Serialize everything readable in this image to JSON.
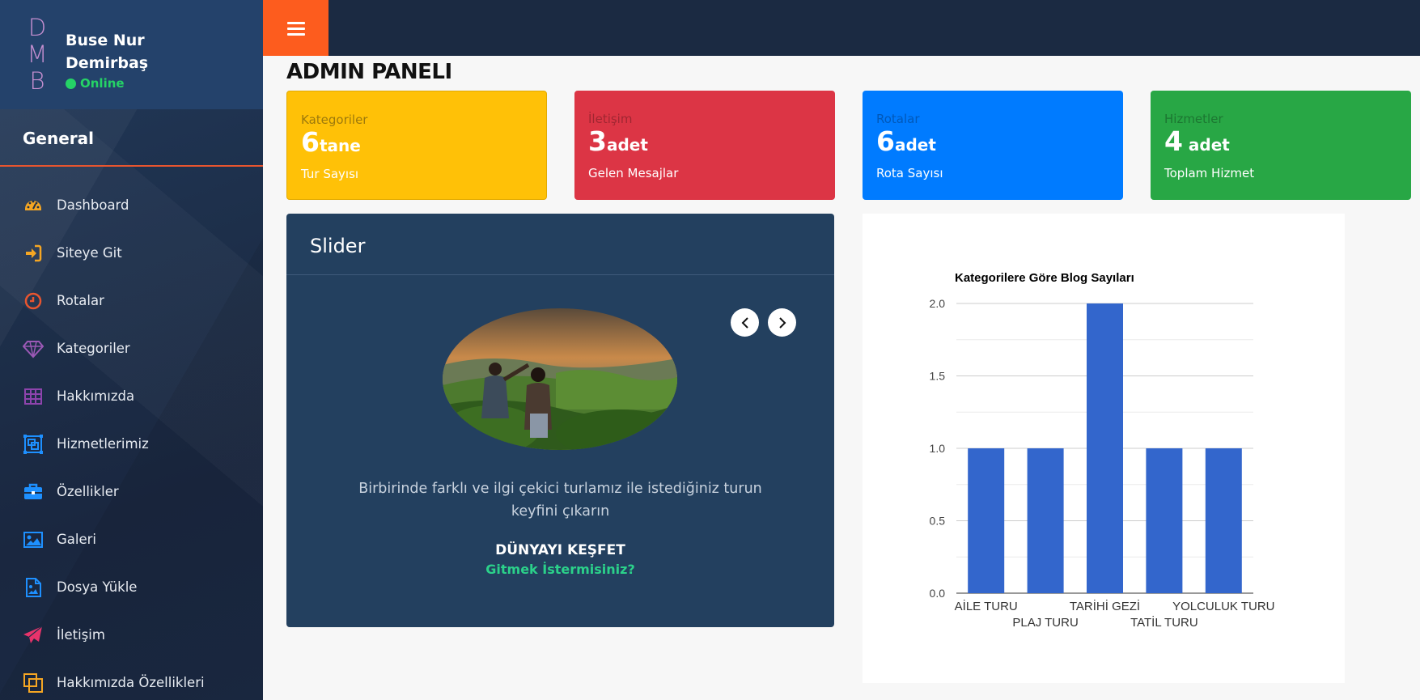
{
  "sidebar": {
    "logo_letters": [
      "D",
      "M",
      "B"
    ],
    "user_name": "Buse Nur Demirbaş",
    "status": "Online",
    "section_title": "General",
    "items": [
      {
        "label": "Dashboard",
        "icon": "speedometer-icon",
        "color": "#f5a623"
      },
      {
        "label": "Siteye Git",
        "icon": "sign-in-icon",
        "color": "#f5a623"
      },
      {
        "label": "Rotalar",
        "icon": "clock-icon",
        "color": "#e8552f"
      },
      {
        "label": "Kategoriler",
        "icon": "diamond-icon",
        "color": "#8e44ad"
      },
      {
        "label": "Hakkımızda",
        "icon": "table-icon",
        "color": "#8e44ad"
      },
      {
        "label": "Hizmetlerimiz",
        "icon": "object-group-icon",
        "color": "#1e90ff"
      },
      {
        "label": "Özellikler",
        "icon": "briefcase-icon",
        "color": "#1e90ff"
      },
      {
        "label": "Galeri",
        "icon": "image-icon",
        "color": "#1e90ff"
      },
      {
        "label": "Dosya Yükle",
        "icon": "file-image-icon",
        "color": "#1e90ff"
      },
      {
        "label": "İletişim",
        "icon": "paper-plane-icon",
        "color": "#e8336b"
      },
      {
        "label": "Hakkımızda Özellikleri",
        "icon": "copy-icon",
        "color": "#f5a623"
      }
    ]
  },
  "header": {
    "menu_icon": "hamburger-icon",
    "page_title": "ADMIN PANELI"
  },
  "cards": [
    {
      "caption": "Kategoriler",
      "number": "6",
      "unit": "tane",
      "subtitle": "Tur Sayısı",
      "color": "#ffc107"
    },
    {
      "caption": "İletişim",
      "number": "3",
      "unit": "adet",
      "subtitle": "Gelen Mesajlar",
      "color": "#dc3545"
    },
    {
      "caption": "Rotalar",
      "number": "6",
      "unit": "adet",
      "subtitle": "Rota Sayısı",
      "color": "#007bff"
    },
    {
      "caption": "Hizmetler",
      "number": "4",
      "unit": " adet",
      "subtitle": "Toplam Hizmet",
      "color": "#28a745"
    }
  ],
  "slider": {
    "title": "Slider",
    "text": "Birbirinde farklı ve ilgi çekici turlamız ile istediğiniz turun keyfini çıkarın",
    "heading": "DÜNYAYI KEŞFET",
    "link": "Gitmek İstermisiniz?"
  },
  "chart_data": {
    "type": "bar",
    "title": "Kategorilere Göre Blog Sayıları",
    "categories": [
      "AİLE TURU",
      "PLAJ TURU",
      "TARİHİ GEZİ",
      "TATİL TURU",
      "YOLCULUK TURU"
    ],
    "values": [
      1,
      1,
      2,
      1,
      1
    ],
    "ylim": [
      0,
      2
    ],
    "yticks": [
      "0.0",
      "0.5",
      "1.0",
      "1.5",
      "2.0"
    ],
    "grid": true,
    "bar_color": "#3366cc",
    "xlabel": "",
    "ylabel": ""
  }
}
